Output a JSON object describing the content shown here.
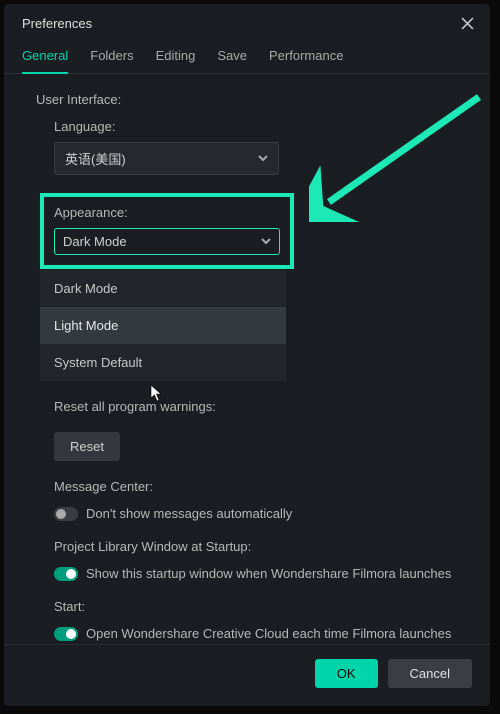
{
  "window": {
    "title": "Preferences"
  },
  "tabs": [
    {
      "label": "General",
      "active": true
    },
    {
      "label": "Folders",
      "active": false
    },
    {
      "label": "Editing",
      "active": false
    },
    {
      "label": "Save",
      "active": false
    },
    {
      "label": "Performance",
      "active": false
    }
  ],
  "ui": {
    "section_label": "User Interface:",
    "language": {
      "label": "Language:",
      "selected": "英语(美国)"
    },
    "appearance": {
      "label": "Appearance:",
      "selected": "Dark Mode",
      "options": [
        {
          "label": "Dark Mode",
          "hovered": false
        },
        {
          "label": "Light Mode",
          "hovered": true
        },
        {
          "label": "System Default",
          "hovered": false
        }
      ]
    },
    "reset": {
      "label": "Reset all program warnings:",
      "button": "Reset"
    },
    "message_center": {
      "label": "Message Center:",
      "toggle_label": "Don't show messages automatically",
      "enabled": false
    },
    "project_library": {
      "label": "Project Library Window at Startup:",
      "toggle_label": "Show this startup window when Wondershare Filmora launches",
      "enabled": true
    },
    "start": {
      "label": "Start:",
      "toggle_label": "Open Wondershare Creative Cloud each time Filmora launches",
      "enabled": true
    }
  },
  "footer": {
    "ok": "OK",
    "cancel": "Cancel"
  },
  "colors": {
    "accent": "#00d4aa",
    "highlight": "#1de9b6"
  }
}
